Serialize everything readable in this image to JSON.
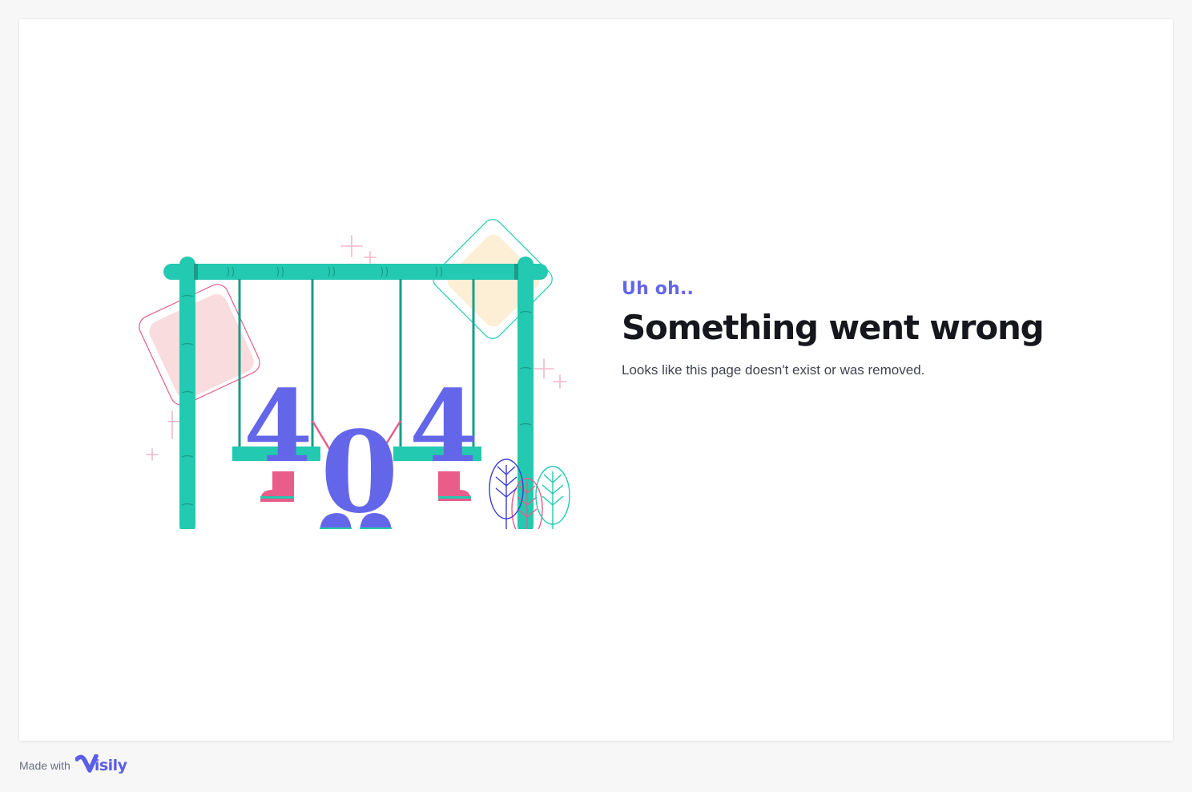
{
  "error_page": {
    "eyebrow": "Uh oh..",
    "headline": "Something went wrong",
    "message": "Looks like this page doesn't exist or was removed.",
    "illustration": {
      "digits": [
        "4",
        "0",
        "4"
      ],
      "icon": "swing-404-illustration"
    }
  },
  "footer": {
    "made_with": "Made with",
    "brand_name": "isily",
    "brand_icon": "visily-logo-icon"
  },
  "colors": {
    "accent": "#6466e9",
    "swing": "#23c9b0",
    "pink": "#e85d8a",
    "cream": "#fcefd6",
    "blush": "#f9dcdd",
    "text": "#15171c"
  }
}
